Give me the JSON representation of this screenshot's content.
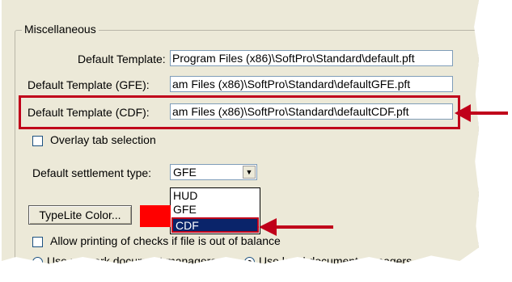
{
  "group": {
    "title": "Miscellaneous"
  },
  "templates": [
    {
      "label": "Default Template:",
      "value": "Program Files (x86)\\SoftPro\\Standard\\default.pft"
    },
    {
      "label": "Default Template (GFE):",
      "value": "am Files (x86)\\SoftPro\\Standard\\defaultGFE.pft"
    },
    {
      "label": "Default Template (CDF):",
      "value": "am Files (x86)\\SoftPro\\Standard\\defaultCDF.pft"
    }
  ],
  "overlay": {
    "label": "Overlay tab selection"
  },
  "settlement": {
    "label": "Default settlement type:",
    "selected": "GFE",
    "options": [
      "HUD",
      "GFE",
      "CDF"
    ],
    "highlighted": "CDF"
  },
  "typelite": {
    "label": "TypeLite Color...",
    "color": "#ff0000"
  },
  "allow_print": {
    "label": "Allow printing of checks if file is out of balance"
  },
  "radios": {
    "network": "Use network document managers",
    "local": "Use local document managers"
  },
  "accent": "#c0001a"
}
